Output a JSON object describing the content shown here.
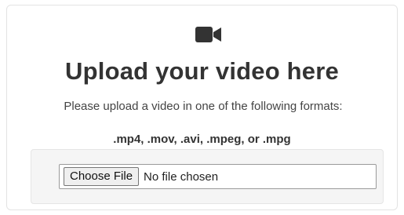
{
  "upload": {
    "icon": "video-camera-icon",
    "title": "Upload your video here",
    "description": "Please upload a video in one of the following formats:",
    "formats": ".mp4, .mov, .avi, .mpeg, or .mpg",
    "file_input": {
      "button_label": "Choose File",
      "status_text": "No file chosen"
    }
  },
  "colors": {
    "text": "#333333",
    "panel_background": "#f5f5f5",
    "icon": "#333333"
  }
}
